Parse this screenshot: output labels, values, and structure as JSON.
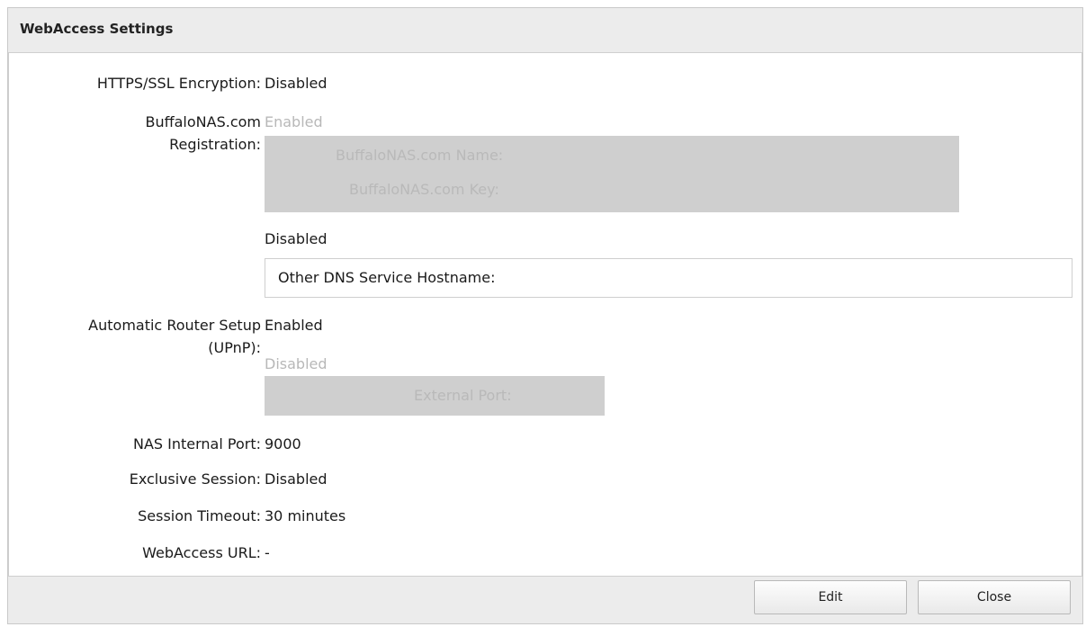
{
  "dialog": {
    "title": "WebAccess Settings",
    "buttons": {
      "edit": "Edit",
      "close": "Close"
    }
  },
  "settings": {
    "https": {
      "label": "HTTPS/SSL Encryption:",
      "value": "Disabled"
    },
    "buffalonas": {
      "label_line1": "BuffaloNAS.com",
      "label_line2": "Registration:",
      "enabled_option": "Enabled",
      "name_field": "BuffaloNAS.com Name:",
      "key_field": "BuffaloNAS.com Key:",
      "disabled_option": "Disabled",
      "other_dns": "Other DNS Service Hostname:"
    },
    "upnp": {
      "label_line1": "Automatic Router Setup",
      "label_line2": "(UPnP):",
      "enabled_option": "Enabled",
      "disabled_option": "Disabled",
      "external_port": "External Port:"
    },
    "internal_port": {
      "label": "NAS Internal Port:",
      "value": "9000"
    },
    "exclusive_session": {
      "label": "Exclusive Session:",
      "value": "Disabled"
    },
    "session_timeout": {
      "label": "Session Timeout:",
      "value": "30 minutes"
    },
    "webaccess_url": {
      "label": "WebAccess URL:",
      "value": "-"
    }
  }
}
